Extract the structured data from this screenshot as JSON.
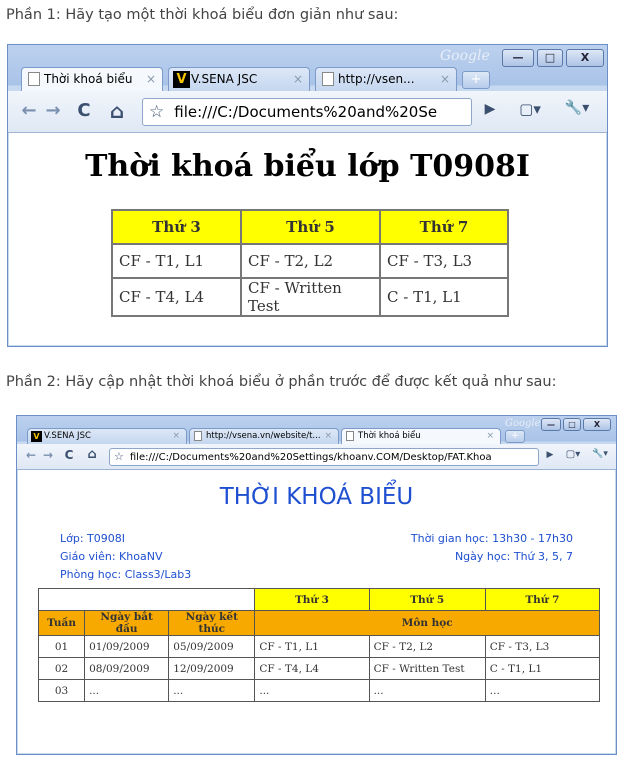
{
  "captions": {
    "part1": "Phần 1: Hãy tạo một thời khoá biểu đơn giản như sau:",
    "part2": "Phần 2: Hãy cập nhật thời khoá biểu ở phần trước để được kết quả như sau:"
  },
  "window1": {
    "brand": "Google",
    "tabs": [
      {
        "label": "Thời khoá biểu",
        "close": "×"
      },
      {
        "label": "V.SENA JSC",
        "close": "×"
      },
      {
        "label": "http://vsen...",
        "close": "×"
      }
    ],
    "vlogo": "V",
    "newtab": "+",
    "controls": {
      "min": "—",
      "max": "□",
      "close": "X"
    },
    "nav": {
      "back": "←",
      "forward": "→",
      "reload": "C",
      "home": "⌂",
      "star": "☆",
      "go": "▶",
      "page": "▢▾",
      "tools": "🔧▾"
    },
    "url": "file:///C:/Documents%20and%20Se",
    "title": "Thời khoá biểu lớp T0908I",
    "table": {
      "headers": [
        "Thứ 3",
        "Thứ 5",
        "Thứ 7"
      ],
      "rows": [
        [
          "CF - T1, L1",
          "CF - T2, L2",
          "CF - T3, L3"
        ],
        [
          "CF - T4, L4",
          "CF - Written Test",
          "C - T1, L1"
        ]
      ]
    }
  },
  "window2": {
    "brand": "Google",
    "tabs": [
      {
        "label": "V.SENA JSC",
        "close": "×"
      },
      {
        "label": "http://vsena.vn/website/t...",
        "close": "×"
      },
      {
        "label": "Thời khoá biểu",
        "close": "×"
      }
    ],
    "vlogo": "V",
    "newtab": "+",
    "controls": {
      "min": "—",
      "max": "□",
      "close": "X"
    },
    "nav": {
      "back": "←",
      "forward": "→",
      "reload": "C",
      "home": "⌂",
      "star": "☆",
      "go": "▶",
      "page": "▢▾",
      "tools": "🔧▾"
    },
    "url": "file:///C:/Documents%20and%20Settings/khoanv.COM/Desktop/FAT.Khoa",
    "title": "THỜI KHOÁ BIỂU",
    "info": {
      "class": "Lớp: T0908I",
      "teacher": "Giáo viên: KhoaNV",
      "room": "Phòng học: Class3/Lab3",
      "time": "Thời gian học: 13h30 - 17h30",
      "days": "Ngày học: Thứ 3, 5, 7"
    },
    "table": {
      "day_headers": [
        "Thứ 3",
        "Thứ 5",
        "Thứ 7"
      ],
      "col_headers": [
        "Tuần",
        "Ngày bắt đầu",
        "Ngày kết thúc"
      ],
      "subject_header": "Môn học",
      "rows": [
        [
          "01",
          "01/09/2009",
          "05/09/2009",
          "CF - T1, L1",
          "CF - T2, L2",
          "CF - T3, L3"
        ],
        [
          "02",
          "08/09/2009",
          "12/09/2009",
          "CF - T4, L4",
          "CF - Written Test",
          "C - T1, L1"
        ],
        [
          "03",
          "...",
          "...",
          "...",
          "...",
          "..."
        ]
      ]
    }
  }
}
